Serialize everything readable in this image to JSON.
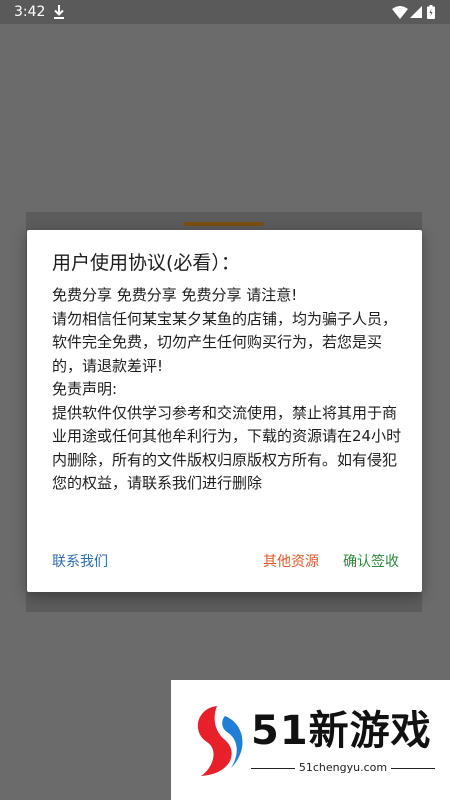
{
  "status_bar": {
    "time": "3:42",
    "icons": [
      "download-icon",
      "wifi-icon",
      "signal-icon",
      "battery-icon"
    ]
  },
  "dialog": {
    "title": "用户使用协议(必看）：",
    "body_lines": [
      "免费分享 免费分享 免费分享 请注意!",
      "请勿相信任何某宝某夕某鱼的店铺，均为骗子人员，软件完全免费，切勿产生任何购买行为，若您是买的，请退款差评!",
      "免责声明:",
      "提供软件仅供学习参考和交流使用，禁止将其用于商业用途或任何其他牟利行为，下载的资源请在24小时内删除，所有的文件版权归原版权方所有。如有侵犯您的权益，请联系我们进行删除"
    ],
    "buttons": {
      "contact": "联系我们",
      "other": "其他资源",
      "confirm": "确认签收"
    }
  },
  "colors": {
    "overlay": "#6b6b6b",
    "contact_button": "#2f6db3",
    "other_button": "#e2592b",
    "confirm_button": "#2e8b3a",
    "accent_bar": "#7a4f10"
  },
  "watermark": {
    "brand": "51新游戏",
    "url": "51chengyu.com"
  }
}
